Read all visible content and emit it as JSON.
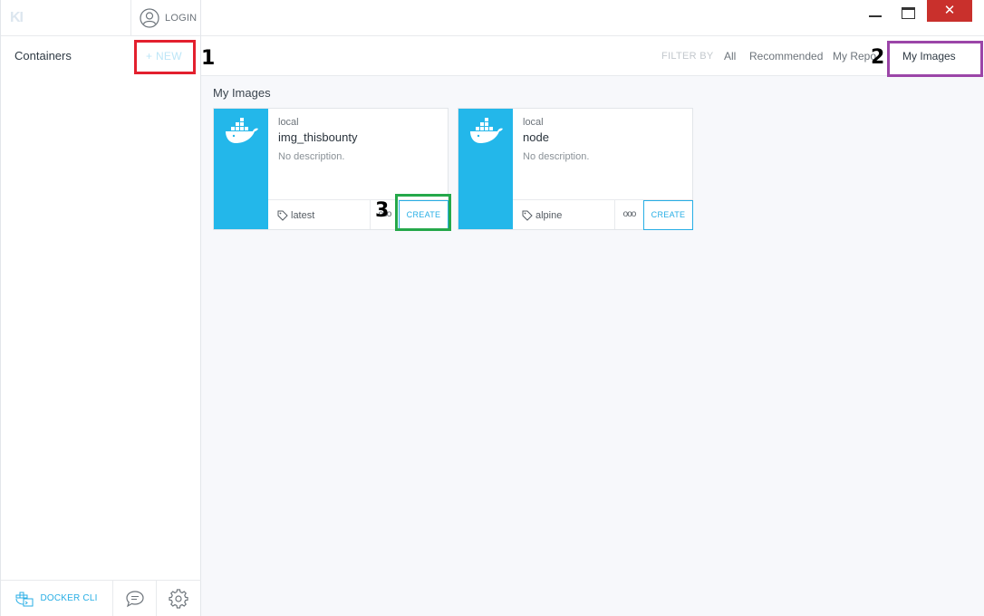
{
  "sidebar": {
    "logo": "KI",
    "login_label": "LOGIN",
    "title": "Containers",
    "new_label": "+ NEW",
    "cli_label": "DOCKER CLI"
  },
  "window": {
    "close_label": "✕"
  },
  "filter": {
    "label": "FILTER BY",
    "items": [
      "All",
      "Recommended",
      "My Repos",
      "My Images"
    ],
    "active": "My Images"
  },
  "section_title": "My Images",
  "images": [
    {
      "namespace": "local",
      "name": "img_thisbounty",
      "description": "No description.",
      "tag": "latest",
      "more": "ooo",
      "action": "CREATE"
    },
    {
      "namespace": "local",
      "name": "node",
      "description": "No description.",
      "tag": "alpine",
      "more": "ooo",
      "action": "CREATE"
    }
  ],
  "annotations": [
    "1",
    "2",
    "3"
  ],
  "colors": {
    "accent": "#23b7ea",
    "close": "#c9302c",
    "annotation_red": "#e3202e",
    "annotation_purple": "#9b45a8",
    "annotation_green": "#25a84a"
  }
}
